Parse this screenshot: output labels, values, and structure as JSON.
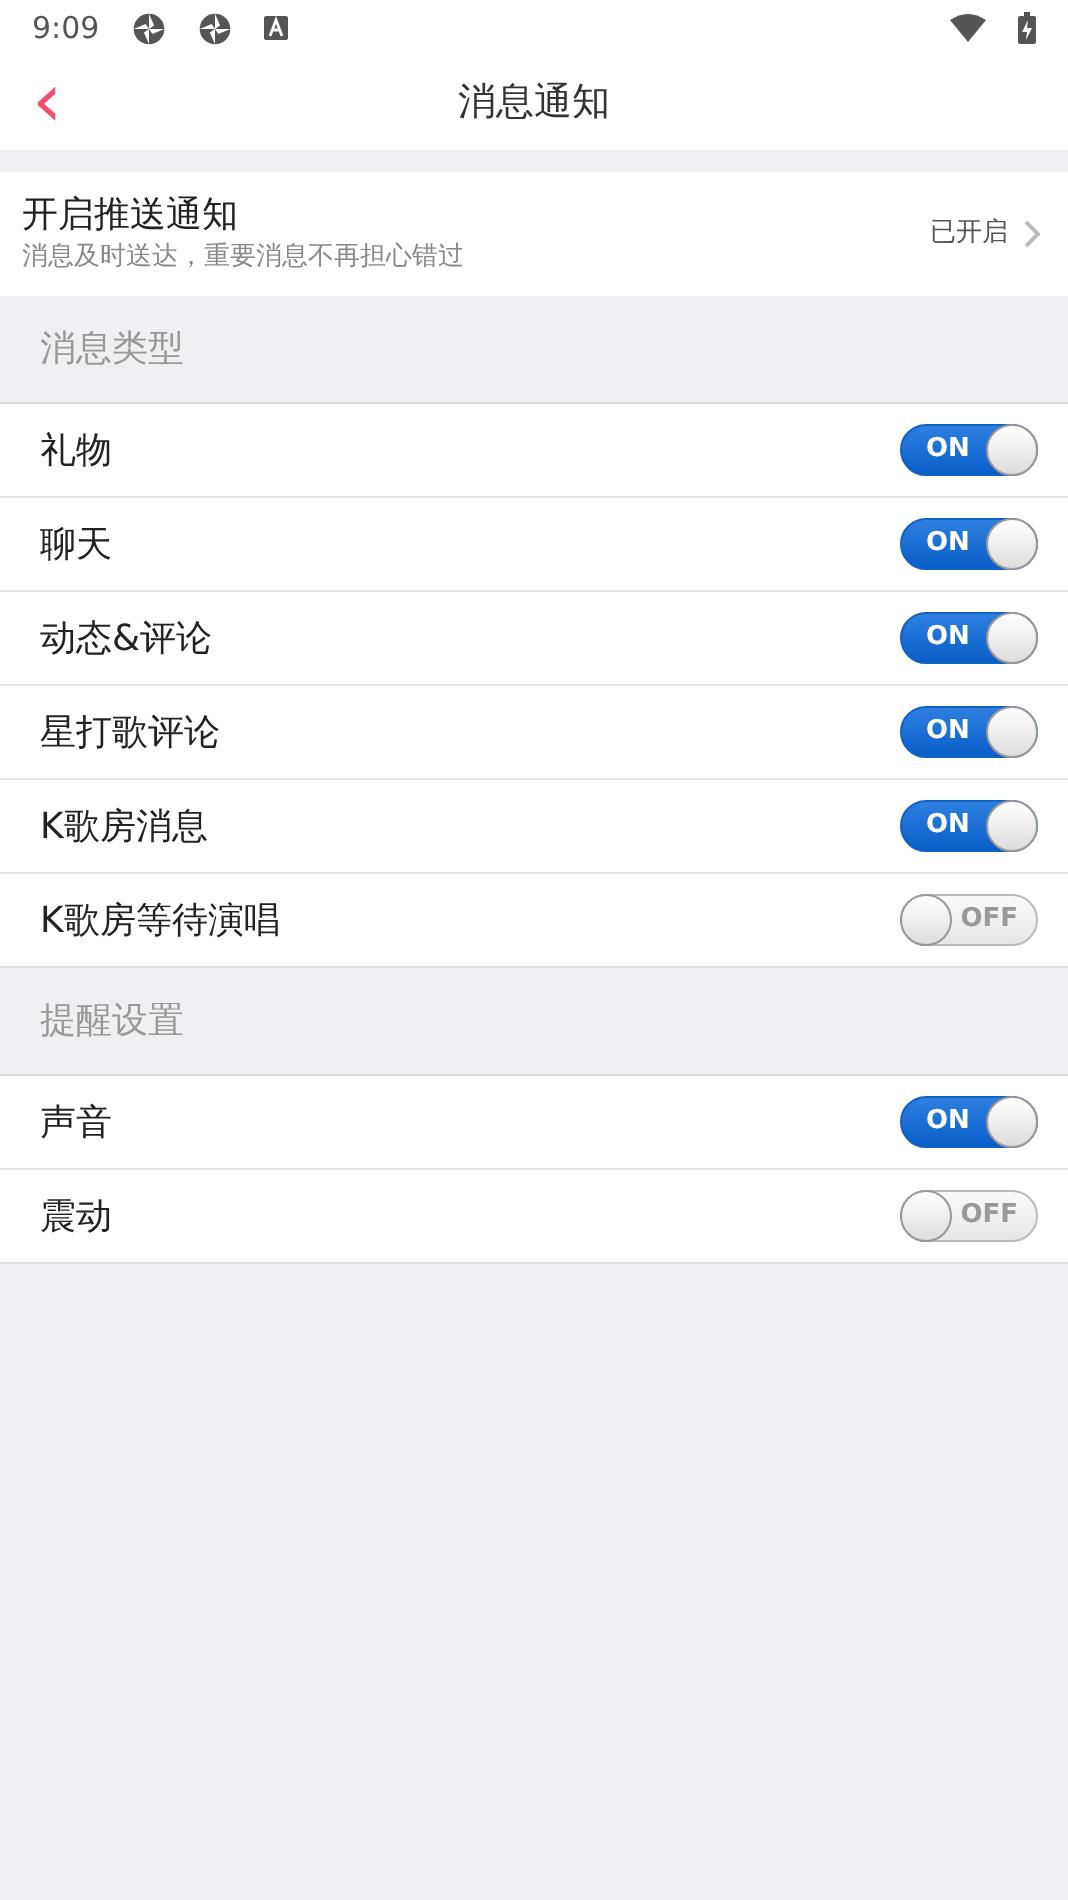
{
  "status_bar": {
    "time": "9:09"
  },
  "header": {
    "back": "‹",
    "title": "消息通知"
  },
  "push": {
    "title": "开启推送通知",
    "subtitle": "消息及时送达，重要消息不再担心错过",
    "value": "已开启"
  },
  "sections": [
    {
      "title": "消息类型",
      "items": [
        {
          "label": "礼物",
          "on": true,
          "switch_text": "ON"
        },
        {
          "label": "聊天",
          "on": true,
          "switch_text": "ON"
        },
        {
          "label": "动态&评论",
          "on": true,
          "switch_text": "ON"
        },
        {
          "label": "星打歌评论",
          "on": true,
          "switch_text": "ON"
        },
        {
          "label": "K歌房消息",
          "on": true,
          "switch_text": "ON"
        },
        {
          "label": "K歌房等待演唱",
          "on": false,
          "switch_text": "OFF"
        }
      ]
    },
    {
      "title": "提醒设置",
      "items": [
        {
          "label": "声音",
          "on": true,
          "switch_text": "ON"
        },
        {
          "label": "震动",
          "on": false,
          "switch_text": "OFF"
        }
      ]
    }
  ]
}
